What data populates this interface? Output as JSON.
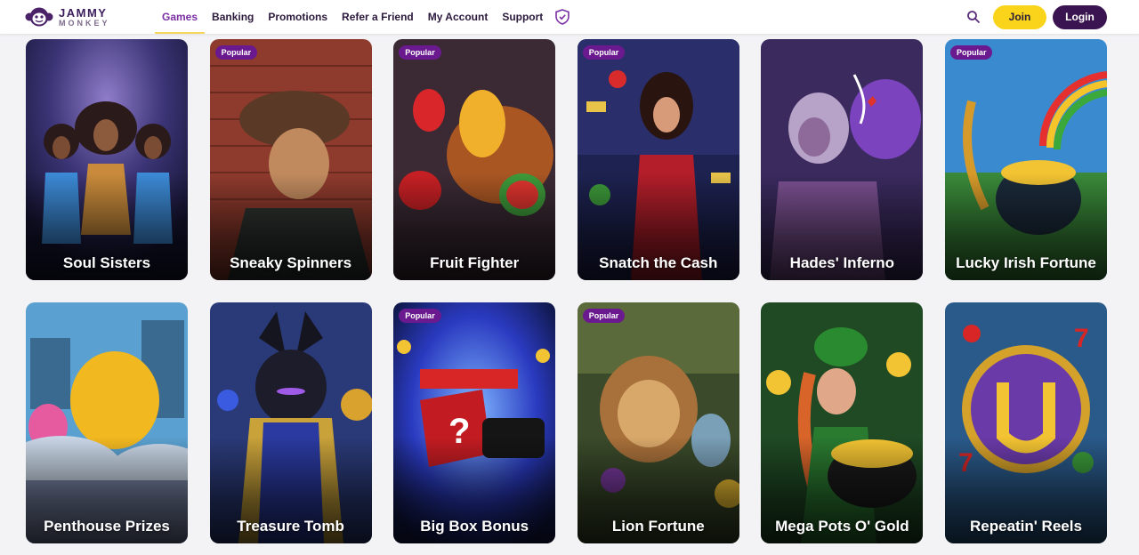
{
  "brand": {
    "line1": "JAMMY",
    "line2": "MONKEY"
  },
  "nav": [
    {
      "label": "Games",
      "active": true
    },
    {
      "label": "Banking"
    },
    {
      "label": "Promotions"
    },
    {
      "label": "Refer a Friend"
    },
    {
      "label": "My Account"
    },
    {
      "label": "Support"
    }
  ],
  "header": {
    "join_label": "Join",
    "login_label": "Login"
  },
  "games": [
    {
      "title": "Soul Sisters",
      "badge": ""
    },
    {
      "title": "Sneaky Spinners",
      "badge": "Popular"
    },
    {
      "title": "Fruit Fighter",
      "badge": "Popular"
    },
    {
      "title": "Snatch the Cash",
      "badge": "Popular"
    },
    {
      "title": "Hades' Inferno",
      "badge": ""
    },
    {
      "title": "Lucky Irish Fortune",
      "badge": "Popular"
    },
    {
      "title": "Penthouse Prizes",
      "badge": ""
    },
    {
      "title": "Treasure Tomb",
      "badge": ""
    },
    {
      "title": "Big Box Bonus",
      "badge": "Popular"
    },
    {
      "title": "Lion Fortune",
      "badge": "Popular"
    },
    {
      "title": "Mega Pots O' Gold",
      "badge": ""
    },
    {
      "title": "Repeatin' Reels",
      "badge": ""
    }
  ],
  "colors": {
    "accent": "#7b2fa5",
    "join": "#f9d41a",
    "login": "#3a1450",
    "badge": "#6a1a8e"
  }
}
